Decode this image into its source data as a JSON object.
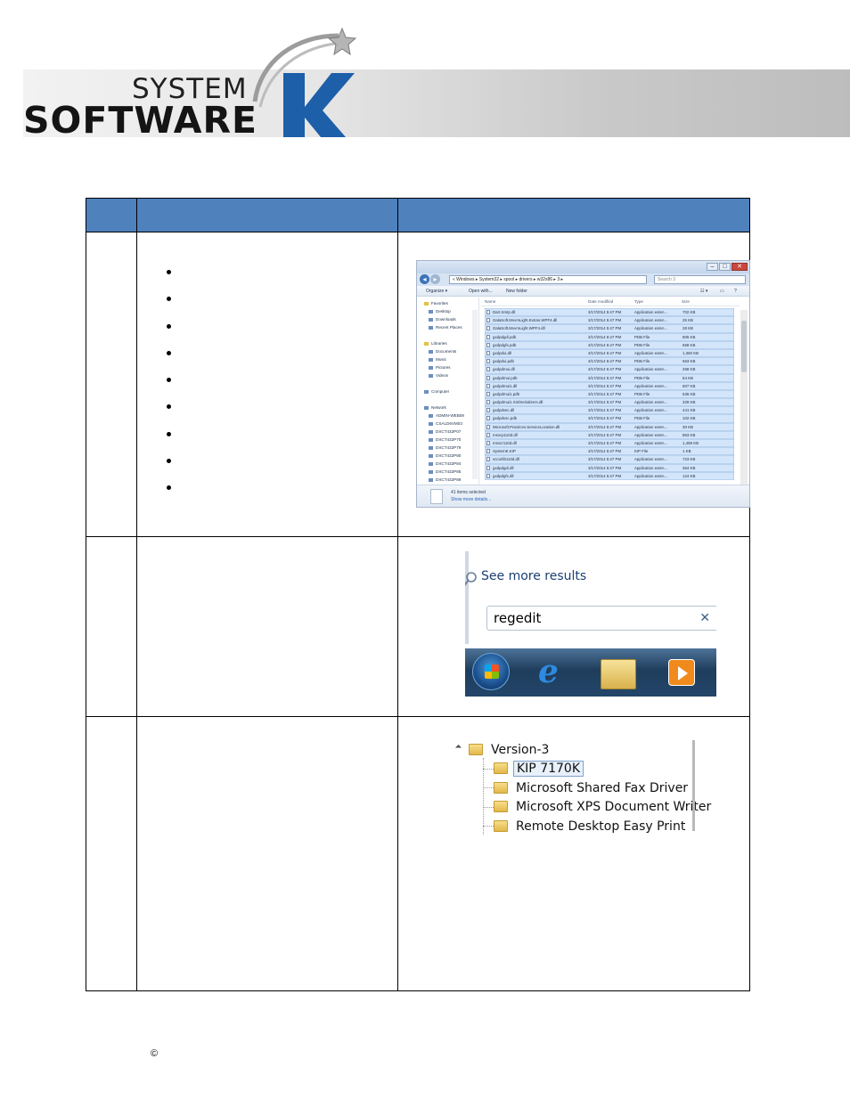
{
  "header": {
    "logo_line1": "SYSTEM",
    "logo_line2": "SOFTWARE",
    "logo_letter": "K"
  },
  "table": {
    "header_cells": [
      "",
      "",
      ""
    ],
    "row1": {
      "bullet_count": 9
    },
    "explorer": {
      "path": "« Windows ▸ System32 ▸ spool ▸ drivers ▸ w32x86 ▸ 3 ▸",
      "search_placeholder": "Search 3",
      "toolbar": [
        "Organize ▾",
        "Open with...",
        "New folder"
      ],
      "nav": [
        {
          "label": "Favorites",
          "icon": "star-icon"
        },
        {
          "label": "Desktop",
          "icon": "desktop-icon"
        },
        {
          "label": "Downloads",
          "icon": "downloads-icon"
        },
        {
          "label": "Recent Places",
          "icon": "recent-icon"
        },
        {
          "label": "Libraries",
          "icon": "library-icon"
        },
        {
          "label": "Documents",
          "icon": "documents-icon"
        },
        {
          "label": "Music",
          "icon": "music-icon"
        },
        {
          "label": "Pictures",
          "icon": "pictures-icon"
        },
        {
          "label": "Videos",
          "icon": "videos-icon"
        },
        {
          "label": "Computer",
          "icon": "computer-icon"
        },
        {
          "label": "Network",
          "icon": "network-icon"
        },
        {
          "label": "ADMIN-WEB08",
          "icon": "pc-icon"
        },
        {
          "label": "CSALD6VM03",
          "icon": "pc-icon"
        },
        {
          "label": "DXCT432P07",
          "icon": "pc-icon"
        },
        {
          "label": "DXCT432P70",
          "icon": "pc-icon"
        },
        {
          "label": "DXCT432P79",
          "icon": "pc-icon"
        },
        {
          "label": "DXCT432P80",
          "icon": "pc-icon"
        },
        {
          "label": "DXCT432P84",
          "icon": "pc-icon"
        },
        {
          "label": "DXCT432P85",
          "icon": "pc-icon"
        },
        {
          "label": "DXCT432P89",
          "icon": "pc-icon"
        }
      ],
      "columns": [
        "Name",
        "Date modified",
        "Type",
        "Size"
      ],
      "files": [
        {
          "name": "Dart.Smtp.dll",
          "date": "3/17/2014 5:47 PM",
          "type": "Application exten...",
          "size": "702 KB",
          "selected": true
        },
        {
          "name": "GalaSoft.MvvmLight.Extras.WPF4.dll",
          "date": "3/17/2014 5:47 PM",
          "type": "Application exten...",
          "size": "25 KB",
          "selected": true
        },
        {
          "name": "GalaSoft.MvvmLight.WPF4.dll",
          "date": "3/17/2014 5:47 PM",
          "type": "Application exten...",
          "size": "28 KB",
          "selected": true
        },
        {
          "name": "gxdpdgdi.pdb",
          "date": "3/17/2014 5:47 PM",
          "type": "PDB File",
          "size": "805 KB",
          "selected": true
        },
        {
          "name": "gxdpdgfx.pdb",
          "date": "3/17/2014 5:47 PM",
          "type": "PDB File",
          "size": "658 KB",
          "selected": true
        },
        {
          "name": "gxdpdui.dll",
          "date": "3/17/2014 5:47 PM",
          "type": "Application exten...",
          "size": "1,360 KB",
          "selected": true
        },
        {
          "name": "gxdpdui.pdb",
          "date": "3/17/2014 5:47 PM",
          "type": "PDB File",
          "size": "563 KB",
          "selected": true
        },
        {
          "name": "gxdpdmui.dll",
          "date": "3/17/2014 5:47 PM",
          "type": "Application exten...",
          "size": "258 KB",
          "selected": true
        },
        {
          "name": "gxdpdmui.pdb",
          "date": "3/17/2014 5:47 PM",
          "type": "PDB File",
          "size": "54 KB",
          "selected": true
        },
        {
          "name": "gxdpdmui1.dll",
          "date": "3/17/2014 5:47 PM",
          "type": "Application exten...",
          "size": "607 KB",
          "selected": true
        },
        {
          "name": "gxdpdmui1.pdb",
          "date": "3/17/2014 5:47 PM",
          "type": "PDB File",
          "size": "536 KB",
          "selected": true
        },
        {
          "name": "gxdpdmui1.XmlSerializers.dll",
          "date": "3/17/2014 5:47 PM",
          "type": "Application exten...",
          "size": "329 KB",
          "selected": true
        },
        {
          "name": "gxdpdvsc.dll",
          "date": "3/17/2014 5:47 PM",
          "type": "Application exten...",
          "size": "441 KB",
          "selected": true
        },
        {
          "name": "gxdpdvsc.pdb",
          "date": "3/17/2014 5:47 PM",
          "type": "PDB File",
          "size": "102 KB",
          "selected": true
        },
        {
          "name": "Microsoft.Practices.ServiceLocation.dll",
          "date": "3/17/2014 5:47 PM",
          "type": "Application exten...",
          "size": "30 KB",
          "selected": true
        },
        {
          "name": "msvcp110d.dll",
          "date": "3/17/2014 5:47 PM",
          "type": "Application exten...",
          "size": "863 KB",
          "selected": true
        },
        {
          "name": "msvcr110d.dll",
          "date": "3/17/2014 5:47 PM",
          "type": "Application exten...",
          "size": "1,459 KB",
          "selected": true
        },
        {
          "name": "SystemK.KIP",
          "date": "3/17/2014 5:47 PM",
          "type": "KIP File",
          "size": "1 KB",
          "selected": true
        },
        {
          "name": "vccorlib110d.dll",
          "date": "3/17/2014 5:47 PM",
          "type": "Application exten...",
          "size": "723 KB",
          "selected": true
        },
        {
          "name": "gxdpdgdi.dll",
          "date": "3/17/2014 5:47 PM",
          "type": "Application exten...",
          "size": "364 KB",
          "selected": true
        },
        {
          "name": "gxdpdgfx.dll",
          "date": "3/17/2014 5:47 PM",
          "type": "Application exten...",
          "size": "124 KB",
          "selected": true
        }
      ],
      "status_count": "41 items selected",
      "status_link": "Show more details..."
    },
    "startmenu": {
      "see_more": "See more results",
      "search_value": "regedit",
      "clear_glyph": "✕"
    },
    "registry": {
      "root": "Version-3",
      "children": [
        {
          "label": "KIP 7170K",
          "selected": true
        },
        {
          "label": "Microsoft Shared Fax Driver",
          "selected": false
        },
        {
          "label": "Microsoft XPS Document Writer",
          "selected": false
        },
        {
          "label": "Remote Desktop Easy Print",
          "selected": false
        }
      ]
    }
  },
  "footer": {
    "copyright_symbol": "©"
  },
  "colors": {
    "table_header": "#4f81bd",
    "logo_blue": "#1d5fa8"
  }
}
